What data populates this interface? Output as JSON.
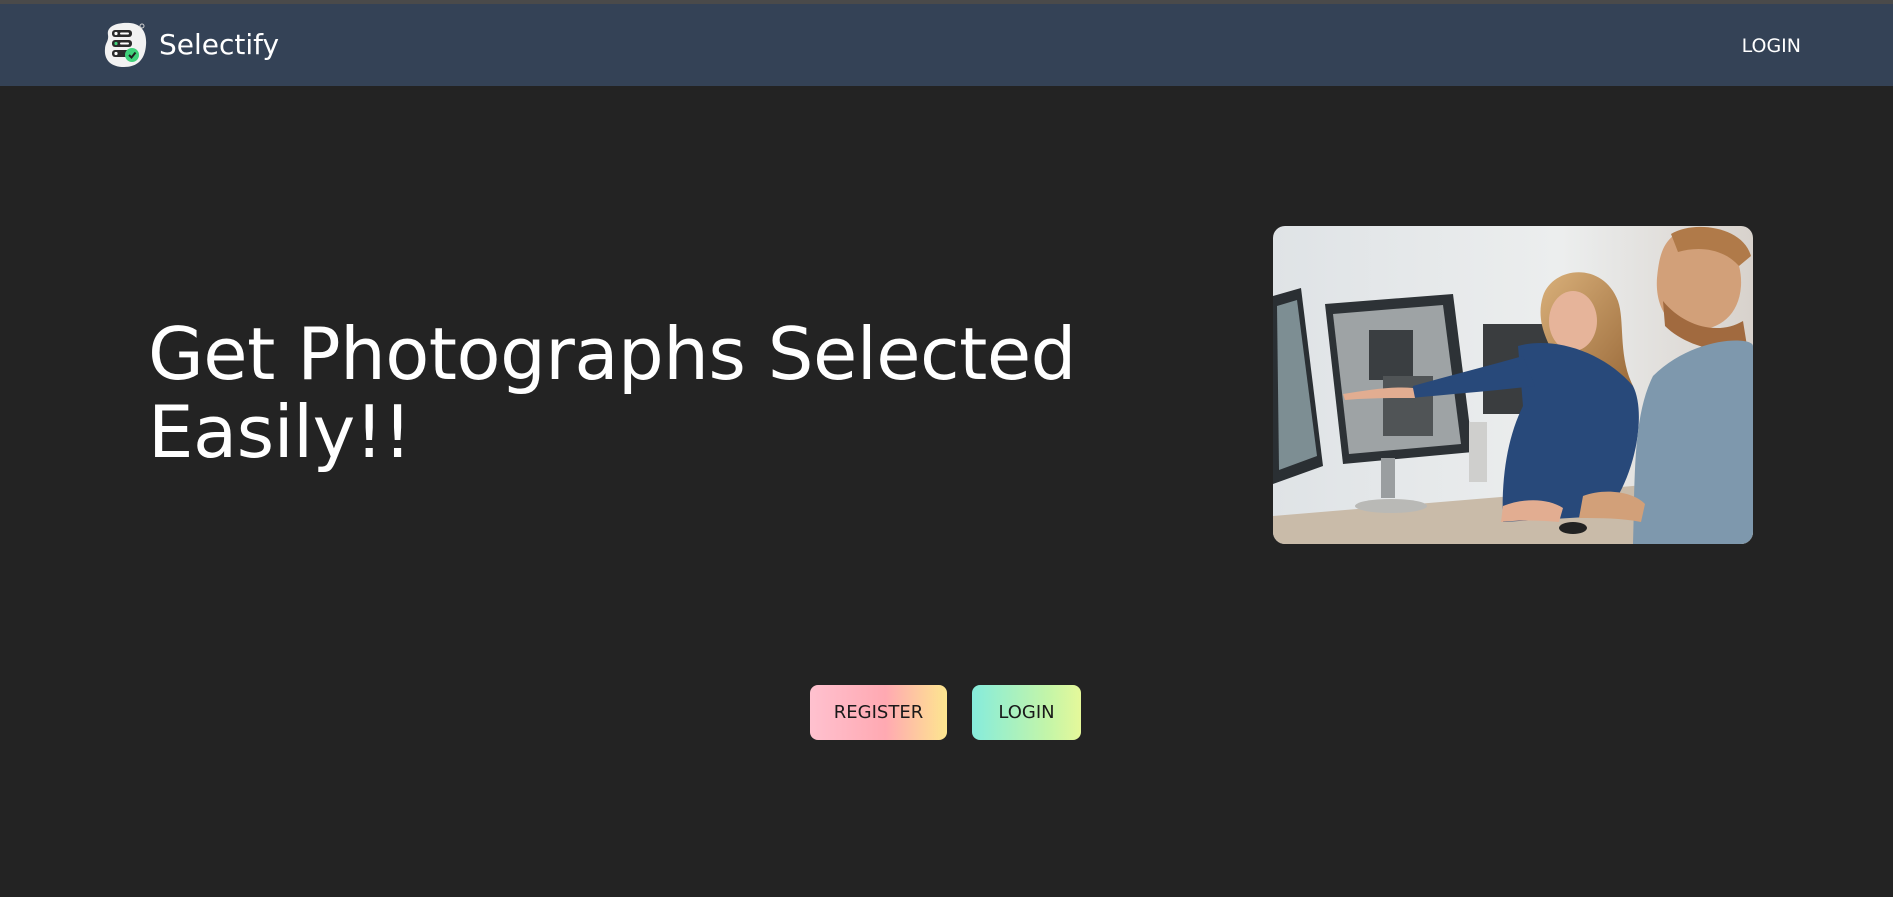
{
  "navbar": {
    "brand": "Selectify",
    "login_label": "LOGIN",
    "logo_icon": "selectify-logo-icon",
    "background": "#344256"
  },
  "hero": {
    "headline": "Get Photographs Selected Easily!!",
    "image": "people-at-computer-photo"
  },
  "actions": {
    "register_label": "REGISTER",
    "login_label": "LOGIN"
  },
  "colors": {
    "page_background": "#232323",
    "register_gradient": [
      "#ffc1cf",
      "#ffa9b2",
      "#fde68f"
    ],
    "login_gradient": [
      "#86ecdc",
      "#c4f5a8",
      "#e5f89a"
    ]
  }
}
